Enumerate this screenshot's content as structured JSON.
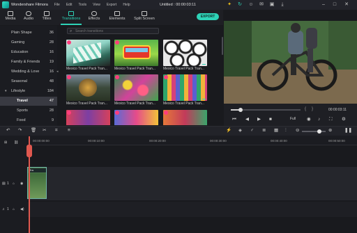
{
  "app": {
    "name": "Wondershare Filmora",
    "document_title": "Untitled : 00:00:03:11"
  },
  "menu": [
    "File",
    "Edit",
    "Tools",
    "View",
    "Export",
    "Help"
  ],
  "media_tabs": [
    "Media",
    "Audio",
    "Titles",
    "Transitions",
    "Effects",
    "Elements",
    "Split Screen"
  ],
  "export_label": "EXPORT",
  "sidebar": {
    "items": [
      {
        "label": "Plain Shape",
        "count": "36"
      },
      {
        "label": "Gaming",
        "count": "28"
      },
      {
        "label": "Education",
        "count": "16"
      },
      {
        "label": "Family & Friends",
        "count": "19"
      },
      {
        "label": "Wedding & Love",
        "count": "16"
      },
      {
        "label": "Seasonal",
        "count": "48"
      },
      {
        "label": "Lifestyle",
        "count": "184"
      },
      {
        "label": "Travel",
        "count": "47"
      },
      {
        "label": "Sports",
        "count": "28"
      },
      {
        "label": "Food",
        "count": "9"
      }
    ]
  },
  "search": {
    "placeholder": "Search transitions"
  },
  "transitions": [
    {
      "caption": "Mexico Travel Pack Tran..."
    },
    {
      "caption": "Mexico Travel Pack Tran..."
    },
    {
      "caption": "Mexico Travel Pack Tran..."
    },
    {
      "caption": "Mexico Travel Pack Tran..."
    },
    {
      "caption": "Mexico Travel Pack Tran..."
    },
    {
      "caption": "Mexico Travel Pack Tran..."
    }
  ],
  "preview": {
    "time": "00:00:03:11",
    "quality": "Full",
    "progress": 0.1
  },
  "timeline": {
    "ruler": [
      "00:00:00:00",
      "00:00:10:00",
      "00:00:20:00",
      "00:00:30:00",
      "00:00:40:00",
      "00:00:50:00"
    ],
    "clip_label": "Tra",
    "track_labels": [
      "1",
      "1"
    ]
  },
  "colors": {
    "accent": "#2ed3b7",
    "playhead": "#e0584f",
    "badge": "#ff3c7d"
  }
}
